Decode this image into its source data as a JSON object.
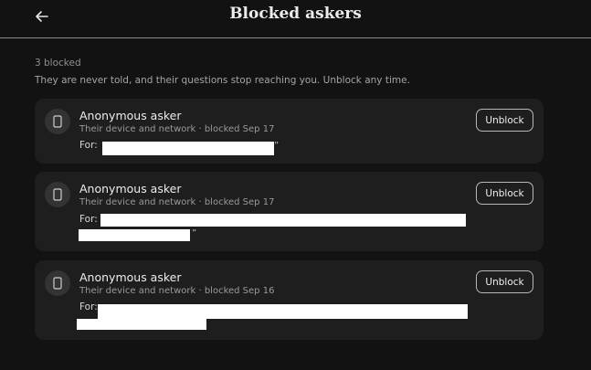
{
  "header": {
    "title": "Blocked askers",
    "back_icon": "arrow-left-icon"
  },
  "summary": {
    "count_text": "3 blocked",
    "description": "They are never told, and their questions stop reaching you. Unblock any time."
  },
  "blocked_list": [
    {
      "name": "Anonymous asker",
      "meta": "Their device and network · blocked Sep 17",
      "for_label": "For:",
      "button_label": "Unblock",
      "icon": "phone-icon"
    },
    {
      "name": "Anonymous asker",
      "meta": "Their device and network · blocked Sep 17",
      "for_label": "For:",
      "button_label": "Unblock",
      "icon": "phone-icon"
    },
    {
      "name": "Anonymous asker",
      "meta": "Their device and network · blocked Sep 16",
      "for_label": "For:",
      "button_label": "Unblock",
      "icon": "phone-icon"
    }
  ],
  "colors": {
    "background": "#121212",
    "card": "#1e1e1e",
    "divider": "#8c8f7d"
  }
}
